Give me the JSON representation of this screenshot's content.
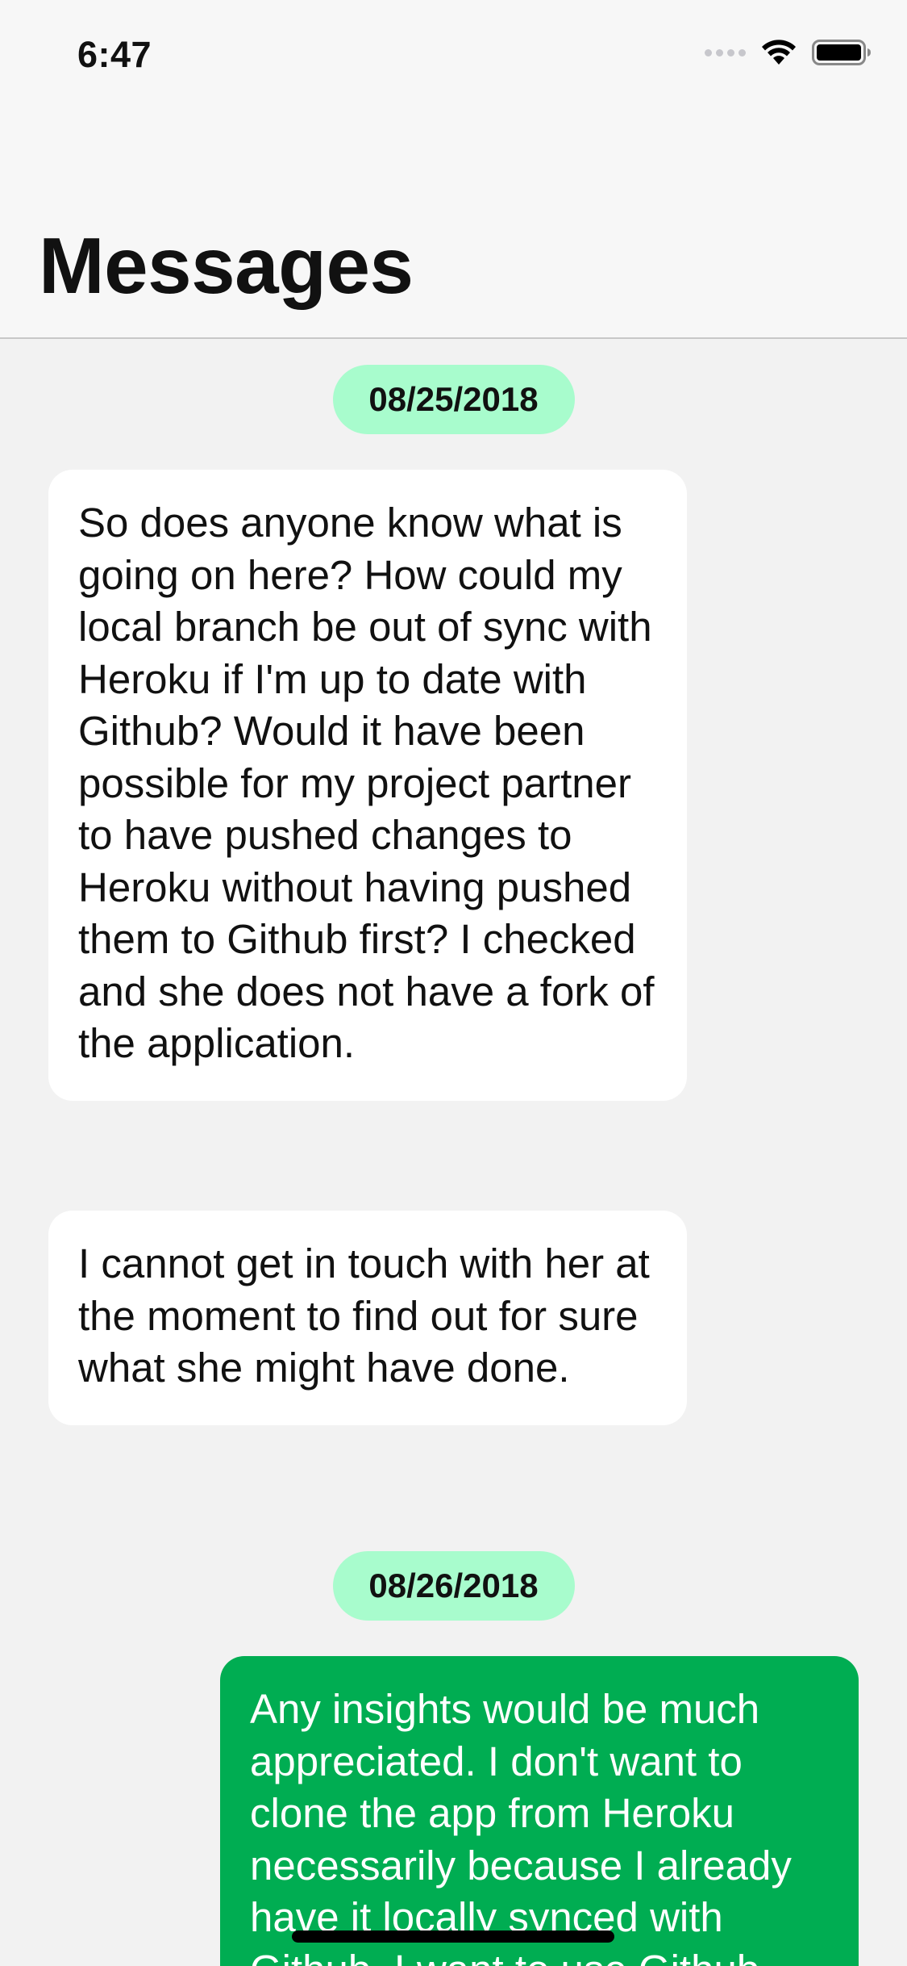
{
  "status_bar": {
    "time": "6:47",
    "icons": [
      "signal-icon",
      "wifi-icon",
      "battery-icon"
    ]
  },
  "header": {
    "title": "Messages"
  },
  "messages": [
    {
      "type": "date",
      "text": "08/25/2018"
    },
    {
      "type": "incoming",
      "text": "So does anyone know what is going on here? How could my local branch be out of sync with Heroku if I'm up to date with Github? Would it have been possible for my project partner to have pushed changes to Heroku without having pushed them to Github first? I checked and she does not have a fork of the application."
    },
    {
      "type": "incoming",
      "text": "I cannot get in touch with her at the moment to find out for sure what she might have done."
    },
    {
      "type": "date",
      "text": "08/26/2018"
    },
    {
      "type": "outgoing",
      "text": "Any insights would be much appreciated. I don't want to clone the app from Heroku necessarily because I already have it locally synced with Github. I want to use Github"
    }
  ],
  "colors": {
    "date_pill": "#a8fccd",
    "incoming_bubble": "#ffffff",
    "outgoing_bubble": "#00ad52",
    "background": "#f2f2f2"
  }
}
